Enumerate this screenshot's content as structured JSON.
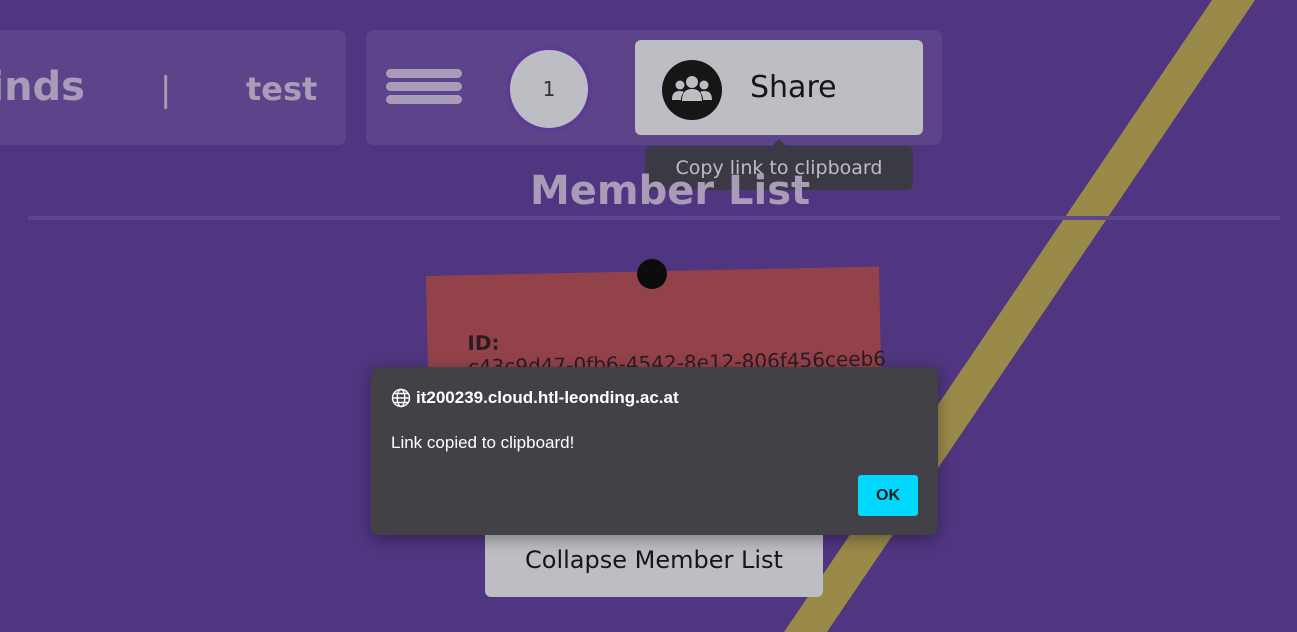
{
  "header": {
    "app_name": "inds",
    "separator": "|",
    "board_name": "test",
    "member_count": "1",
    "share_label": "Share",
    "share_tooltip": "Copy link to clipboard"
  },
  "member_list": {
    "title": "Member List",
    "note": {
      "id_label": "ID:",
      "id_value": "c43c9d47-0fb6-4542-8e12-806f456ceeb6"
    },
    "collapse_label": "Collapse Member List"
  },
  "alert": {
    "origin": "it200239.cloud.htl-leonding.ac.at",
    "message": "Link copied to clipboard!",
    "ok_label": "OK"
  },
  "icons": {
    "menu": "hamburger-menu-icon",
    "share": "group-icon",
    "origin": "globe-icon"
  },
  "colors": {
    "background": "#503580",
    "stripe": "#9a8a4a",
    "panel": "#bdbdc4",
    "note": "#944249",
    "dialog": "#424148",
    "ok_button": "#00d8ff"
  }
}
